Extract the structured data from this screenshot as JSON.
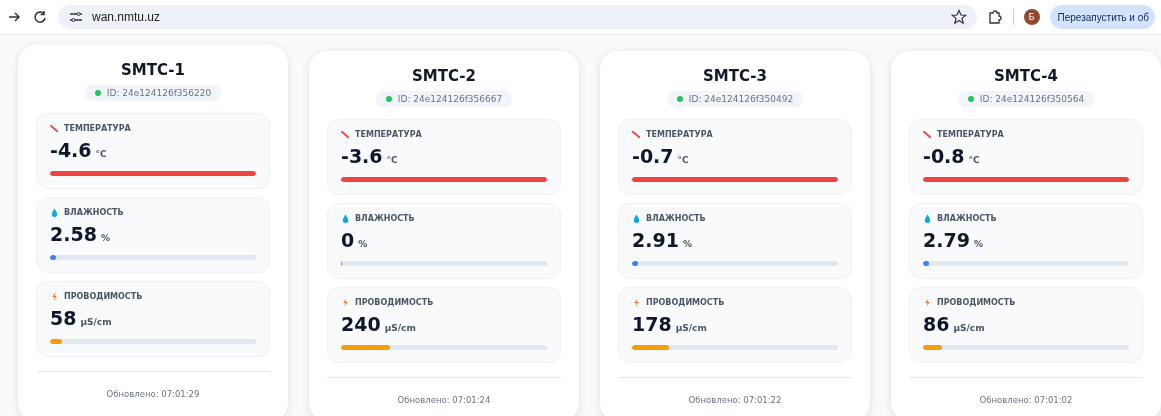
{
  "browser": {
    "url": "wan.nmtu.uz",
    "avatar": "Б",
    "restart_button": "Перезапустить и об"
  },
  "devices": [
    {
      "name": "SMTC-1",
      "id": "ID: 24e124126f356220",
      "online": true,
      "updated": "Обновлено: 07:01:29",
      "metrics": [
        {
          "kind": "temperature",
          "label": "ТЕМПЕРАТУРА",
          "value": "-4.6",
          "unit": "°C",
          "level": 1
        },
        {
          "kind": "humidity",
          "label": "ВЛАЖНОСТЬ",
          "value": "2.58",
          "unit": "%",
          "level": 0.03
        },
        {
          "kind": "conductivity",
          "label": "ПРОВОДИМОСТЬ",
          "value": "58",
          "unit": "µS/cm",
          "level": 0.06
        }
      ]
    },
    {
      "name": "SMTC-2",
      "id": "ID: 24e124126f356667",
      "online": true,
      "updated": "Обновлено: 07:01:24",
      "metrics": [
        {
          "kind": "temperature",
          "label": "ТЕМПЕРАТУРА",
          "value": "-3.6",
          "unit": "°C",
          "level": 1
        },
        {
          "kind": "humidity",
          "label": "ВЛАЖНОСТЬ",
          "value": "0",
          "unit": "%",
          "level": 0
        },
        {
          "kind": "conductivity",
          "label": "ПРОВОДИМОСТЬ",
          "value": "240",
          "unit": "µS/cm",
          "level": 0.24
        }
      ]
    },
    {
      "name": "SMTC-3",
      "id": "ID: 24e124126f350492",
      "online": true,
      "updated": "Обновлено: 07:01:22",
      "metrics": [
        {
          "kind": "temperature",
          "label": "ТЕМПЕРАТУРА",
          "value": "-0.7",
          "unit": "°C",
          "level": 1
        },
        {
          "kind": "humidity",
          "label": "ВЛАЖНОСТЬ",
          "value": "2.91",
          "unit": "%",
          "level": 0.03
        },
        {
          "kind": "conductivity",
          "label": "ПРОВОДИМОСТЬ",
          "value": "178",
          "unit": "µS/cm",
          "level": 0.18
        }
      ]
    },
    {
      "name": "SMTC-4",
      "id": "ID: 24e124126f350564",
      "online": true,
      "updated": "Обновлено: 07:01:02",
      "metrics": [
        {
          "kind": "temperature",
          "label": "ТЕМПЕРАТУРА",
          "value": "-0.8",
          "unit": "°C",
          "level": 1
        },
        {
          "kind": "humidity",
          "label": "ВЛАЖНОСТЬ",
          "value": "2.79",
          "unit": "%",
          "level": 0.03
        },
        {
          "kind": "conductivity",
          "label": "ПРОВОДИМОСТЬ",
          "value": "86",
          "unit": "µS/cm",
          "level": 0.09
        }
      ]
    }
  ]
}
